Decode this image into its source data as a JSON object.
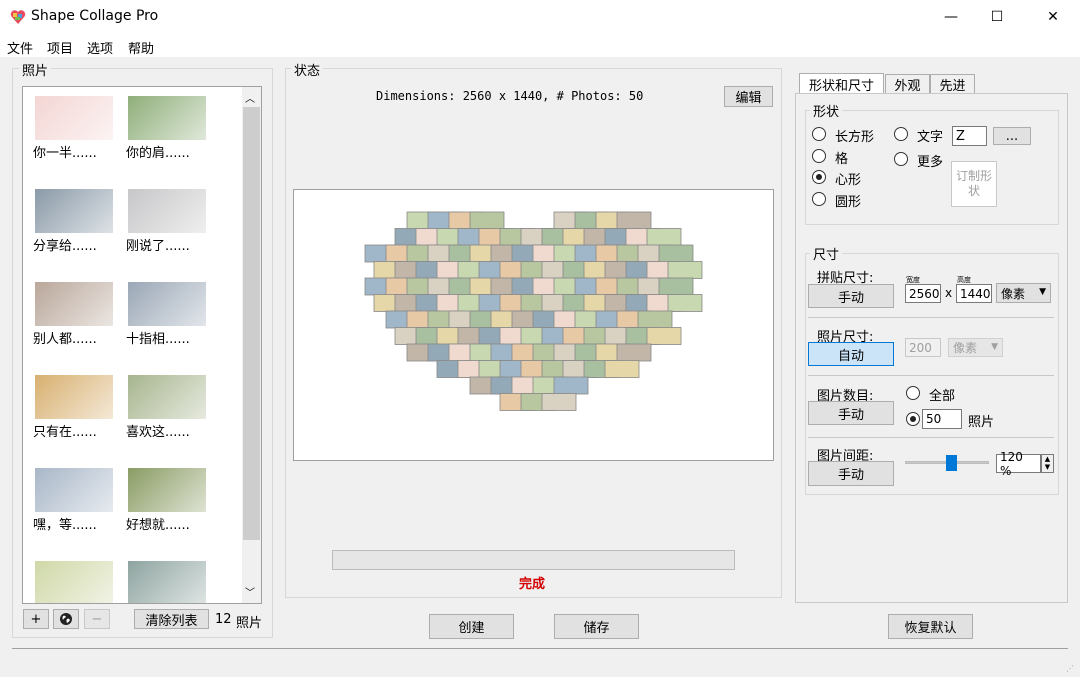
{
  "window": {
    "title": "Shape Collage Pro",
    "minimize": "—",
    "maximize": "☐",
    "close": "✕"
  },
  "menu": [
    "文件",
    "项目",
    "选项",
    "帮助"
  ],
  "photos_panel": {
    "legend": "照片",
    "items": [
      {
        "label": "你一半......",
        "thumb_color": "#f3d6d4"
      },
      {
        "label": "你的肩......",
        "thumb_color": "#8fae7a"
      },
      {
        "label": "分享给......",
        "thumb_color": "#8a9aa8"
      },
      {
        "label": "刚说了......",
        "thumb_color": "#c7c7c9"
      },
      {
        "label": "别人都......",
        "thumb_color": "#b9a79a"
      },
      {
        "label": "十指相......",
        "thumb_color": "#9aa7b6"
      },
      {
        "label": "只有在......",
        "thumb_color": "#d8b070"
      },
      {
        "label": "喜欢这......",
        "thumb_color": "#a7b58e"
      },
      {
        "label": "嘿，等......",
        "thumb_color": "#a9b7c8"
      },
      {
        "label": "好想就......",
        "thumb_color": "#8a9c64"
      },
      {
        "label": "",
        "thumb_color": "#cfd8a7"
      },
      {
        "label": "",
        "thumb_color": "#8ea4a0"
      }
    ],
    "add": "+",
    "web": "globe-icon",
    "remove": "−",
    "clear": "清除列表",
    "count": "12",
    "count_unit": "照片"
  },
  "status_panel": {
    "legend": "状态",
    "dimensions_text": "Dimensions: 2560 x 1440, # Photos: 50",
    "edit": "编辑",
    "progress_fraction": 0,
    "status": "完成"
  },
  "actions": {
    "create": "创建",
    "save": "储存",
    "restore": "恢复默认"
  },
  "tabs": [
    "形状和尺寸",
    "外观",
    "先进"
  ],
  "shape": {
    "legend": "形状",
    "options": {
      "rect": "长方形",
      "grid": "格",
      "heart": "心形",
      "circle": "圆形",
      "text": "文字",
      "more": "更多"
    },
    "selected": "heart",
    "text_value": "Z",
    "ellipsis": "...",
    "custom_shape": "订制形状"
  },
  "size": {
    "legend": "尺寸",
    "collage_size_label": "拼贴尺寸:",
    "collage_mode": "手动",
    "width_caption": "宽度",
    "height_caption": "高度",
    "width": "2560",
    "times": "x",
    "height": "1440",
    "unit": "像素",
    "photo_size_label": "照片尺寸:",
    "photo_mode": "自动",
    "photo_size": "200",
    "photo_unit": "像素",
    "photo_count_label": "图片数目:",
    "count_mode": "手动",
    "all": "全部",
    "count_value": "50",
    "count_unit": "照片",
    "spacing_label": "图片间距:",
    "spacing_mode": "手动",
    "spacing_value": "120 %",
    "spacing_level": 0.55
  }
}
